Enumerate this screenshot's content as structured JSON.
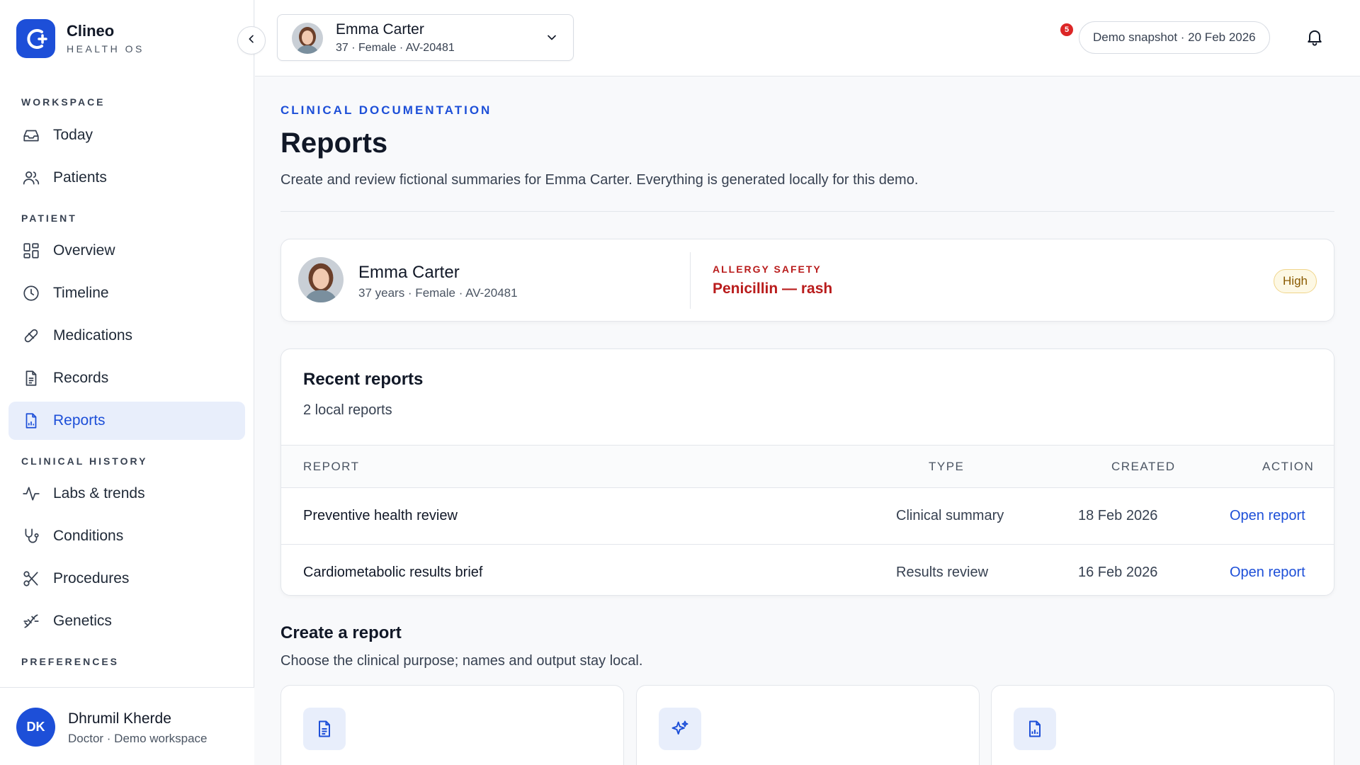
{
  "brand": {
    "name": "Clineo",
    "subtitle": "HEALTH OS"
  },
  "sidebar": {
    "sections": {
      "workspace": "WORKSPACE",
      "patient": "PATIENT",
      "clinical_history": "CLINICAL HISTORY",
      "preferences": "PREFERENCES"
    },
    "items": [
      {
        "label": "Today",
        "icon": "inbox-icon"
      },
      {
        "label": "Patients",
        "icon": "users-icon"
      },
      {
        "label": "Overview",
        "icon": "grid-icon"
      },
      {
        "label": "Timeline",
        "icon": "clock-icon"
      },
      {
        "label": "Medications",
        "icon": "pill-icon"
      },
      {
        "label": "Records",
        "icon": "document-icon"
      },
      {
        "label": "Reports",
        "icon": "report-icon",
        "active": true
      },
      {
        "label": "Labs & trends",
        "icon": "activity-icon"
      },
      {
        "label": "Conditions",
        "icon": "stethoscope-icon"
      },
      {
        "label": "Procedures",
        "icon": "scissors-icon"
      },
      {
        "label": "Genetics",
        "icon": "dna-icon"
      }
    ],
    "user": {
      "initials": "DK",
      "name": "Dhrumil Kherde",
      "role": "Doctor · Demo workspace"
    }
  },
  "topbar": {
    "patient": {
      "name": "Emma Carter",
      "meta": "37 · Female · AV-20481"
    },
    "snapshot": "Demo snapshot · 20 Feb 2026",
    "notifications": "5"
  },
  "page": {
    "eyebrow": "CLINICAL DOCUMENTATION",
    "title": "Reports",
    "subtitle": "Create and review fictional summaries for Emma Carter. Everything is generated locally for this demo."
  },
  "patient_card": {
    "name": "Emma Carter",
    "meta": "37 years · Female · AV-20481",
    "allergy_label": "ALLERGY SAFETY",
    "allergy_value": "Penicillin — rash",
    "severity": "High"
  },
  "recent_reports": {
    "title": "Recent reports",
    "count": "2 local reports",
    "columns": {
      "report": "REPORT",
      "type": "TYPE",
      "created": "CREATED",
      "action": "ACTION"
    },
    "rows": [
      {
        "name": "Preventive health review",
        "type": "Clinical summary",
        "created": "18 Feb 2026",
        "action": "Open report"
      },
      {
        "name": "Cardiometabolic results brief",
        "type": "Results review",
        "created": "16 Feb 2026",
        "action": "Open report"
      }
    ]
  },
  "create": {
    "title": "Create a report",
    "subtitle": "Choose the clinical purpose; names and output stay local.",
    "templates": [
      {
        "icon": "document-icon"
      },
      {
        "icon": "sparkles-icon"
      },
      {
        "icon": "report-chart-icon"
      }
    ]
  },
  "colors": {
    "accent": "#1d4fd8",
    "danger": "#b91c1c",
    "badge": "#dc2626"
  }
}
